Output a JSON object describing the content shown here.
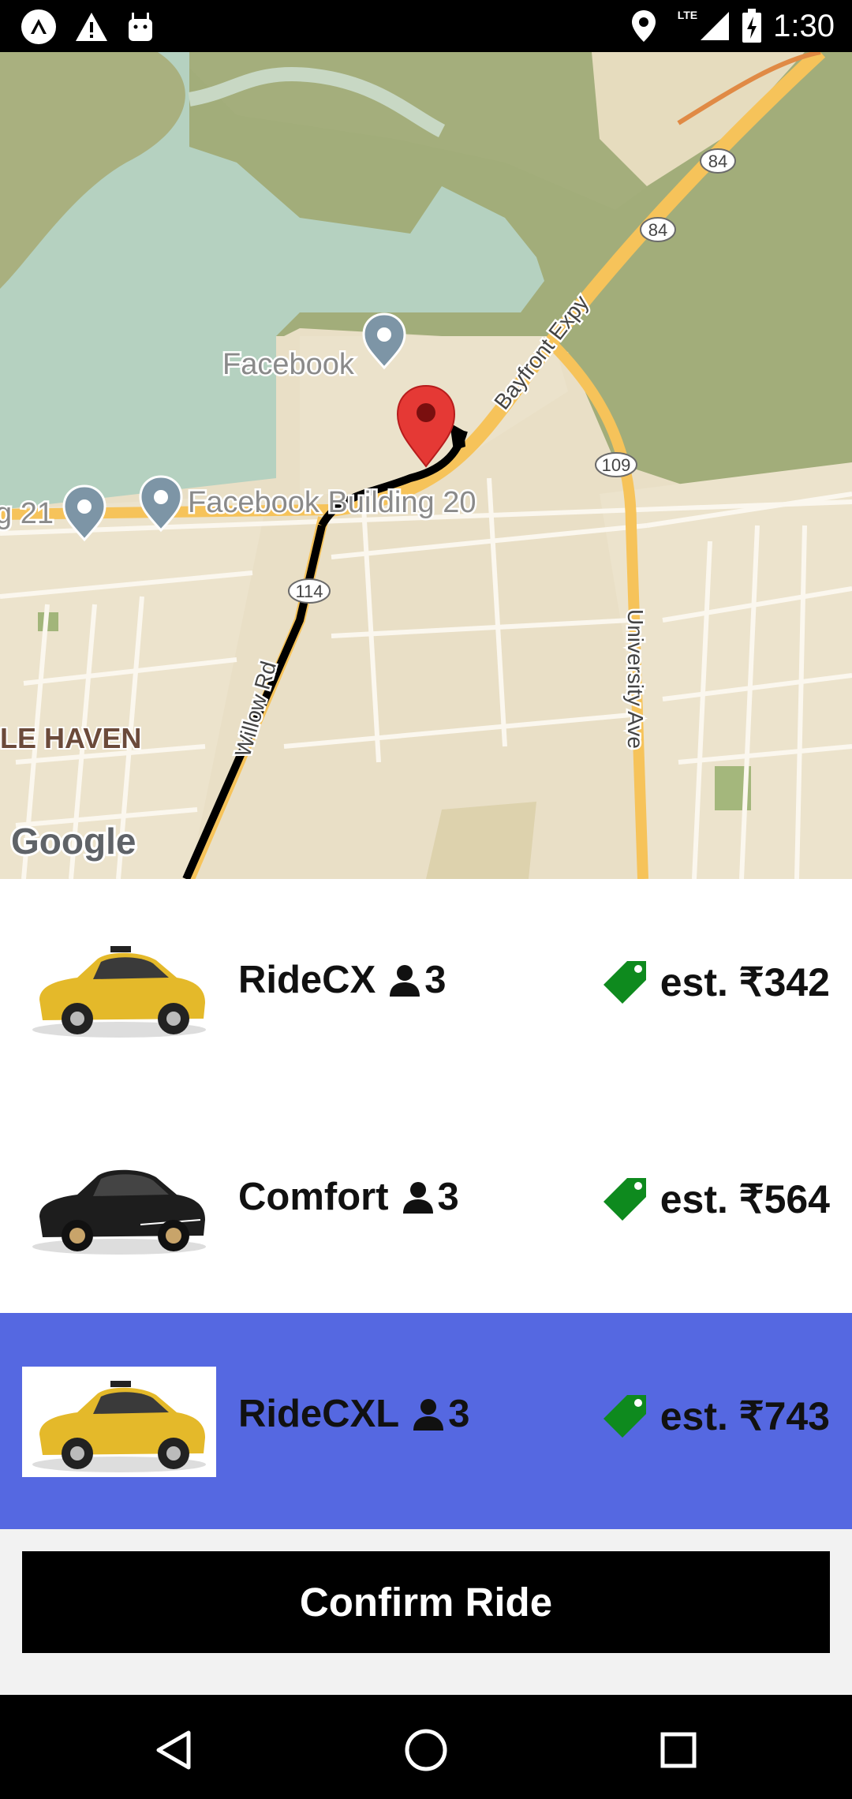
{
  "status_bar": {
    "time": "1:30",
    "network": "LTE",
    "left_icons": [
      "launcher-icon",
      "warning-icon",
      "android-debug-icon"
    ],
    "right_icons": [
      "location-icon",
      "signal-icon",
      "battery-icon"
    ]
  },
  "map": {
    "labels": {
      "facebook": "Facebook",
      "facebook_building_20": "Facebook Building 20",
      "building_21": "g 21",
      "bayfront": "Bayfront Expy",
      "willow": "Willow Rd",
      "university": "University Ave",
      "haven": "LE HAVEN",
      "google": "Google"
    },
    "shields": {
      "r84_a": "84",
      "r84_b": "84",
      "r109": "109",
      "r114": "114"
    }
  },
  "rides": [
    {
      "name": "RideCX",
      "capacity": "3",
      "price": "est. ₹342",
      "car_color": "yellow",
      "selected": false
    },
    {
      "name": "Comfort",
      "capacity": "3",
      "price": "est. ₹564",
      "car_color": "black",
      "selected": false
    },
    {
      "name": "RideCXL",
      "capacity": "3",
      "price": "est. ₹743",
      "car_color": "yellow",
      "selected": true
    }
  ],
  "confirm_label": "Confirm Ride",
  "colors": {
    "selected_row": "#5568e1",
    "price_tag": "#0e8a1e",
    "pin": "#e53935"
  },
  "nav": [
    "back-icon",
    "home-icon",
    "recents-icon"
  ]
}
